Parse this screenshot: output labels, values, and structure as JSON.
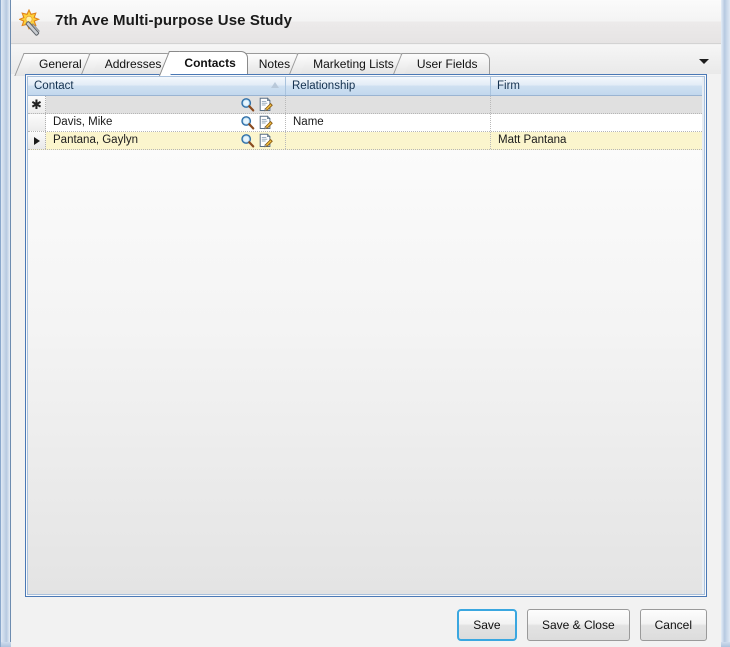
{
  "window": {
    "title": "7th Ave Multi-purpose Use Study",
    "icon": "magic-wand-icon"
  },
  "tabs": [
    {
      "label": "General",
      "active": false
    },
    {
      "label": "Addresses",
      "active": false
    },
    {
      "label": "Contacts",
      "active": true
    },
    {
      "label": "Notes",
      "active": false
    },
    {
      "label": "Marketing Lists",
      "active": false
    },
    {
      "label": "User Fields",
      "active": false
    }
  ],
  "tab_overflow_icon": "chevron-down-icon",
  "grid": {
    "columns": [
      {
        "key": "contact",
        "label": "Contact",
        "sorted": "ascending"
      },
      {
        "key": "relationship",
        "label": "Relationship",
        "sorted": ""
      },
      {
        "key": "firm",
        "label": "Firm",
        "sorted": ""
      }
    ],
    "row_icons": [
      "search-icon",
      "edit-document-icon"
    ],
    "rows": [
      {
        "indicator": "new-row-asterisk",
        "state": "new",
        "contact": "",
        "relationship": "",
        "firm": "",
        "has_icons": true
      },
      {
        "indicator": "",
        "state": "plain",
        "contact": "Davis, Mike",
        "relationship": "Name",
        "firm": "",
        "has_icons": true
      },
      {
        "indicator": "current-row-caret",
        "state": "selected",
        "contact": "Pantana, Gaylyn",
        "relationship": "",
        "firm": "Matt Pantana",
        "has_icons": true
      }
    ]
  },
  "footer": {
    "buttons": [
      {
        "label": "Save",
        "focused": true
      },
      {
        "label": "Save & Close",
        "focused": false
      },
      {
        "label": "Cancel",
        "focused": false
      }
    ]
  },
  "colors": {
    "frame_border": "#4a78b5",
    "header_gradient_top": "#f4f8fc",
    "header_gradient_bottom": "#c2d8ee",
    "selected_row": "#fbf5cd",
    "focus_ring": "#3aa7e0"
  }
}
